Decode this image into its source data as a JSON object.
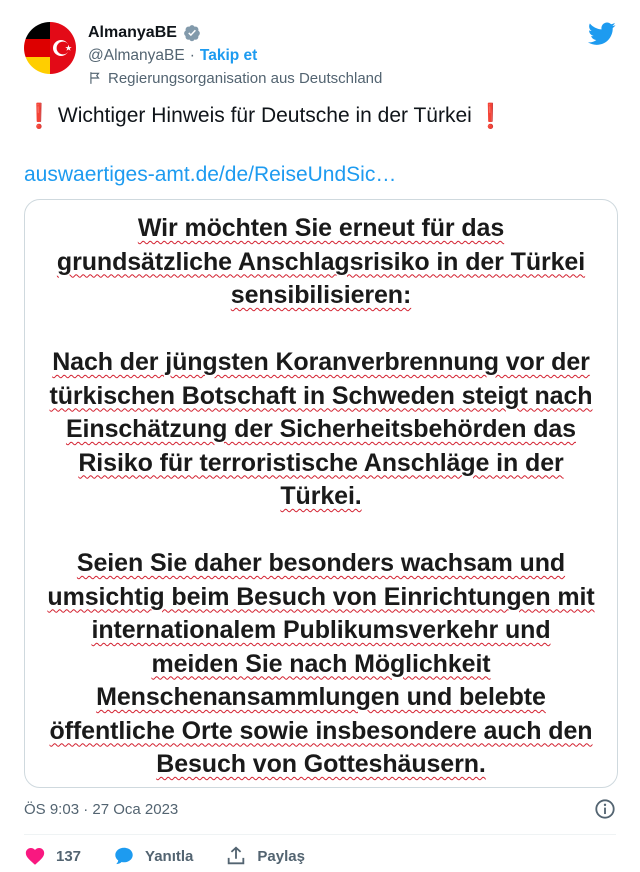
{
  "account": {
    "display_name": "AlmanyaBE",
    "handle": "@AlmanyaBE",
    "separator": "·",
    "follow_label": "Takip et",
    "affiliation": "Regierungsorganisation aus Deutschland"
  },
  "tweet": {
    "emoji_left": "❗",
    "text": "Wichtiger Hinweis für Deutsche in der Türkei",
    "emoji_right": "❗",
    "link": "auswaertiges-amt.de/de/ReiseUndSic…"
  },
  "media": {
    "paragraphs": [
      [
        "Wir möchten Sie erneut für das",
        "grundsätzliche Anschlagsrisiko in der Türkei",
        "sensibilisieren:"
      ],
      [
        "Nach der jüngsten Koranverbrennung vor der",
        "türkischen Botschaft in Schweden steigt nach",
        "Einschätzung der Sicherheitsbehörden das",
        "Risiko für terroristische Anschläge in der",
        "Türkei."
      ],
      [
        "Seien Sie daher besonders wachsam und",
        "umsichtig beim Besuch von Einrichtungen mit",
        "internationalem Publikumsverkehr und",
        "meiden Sie nach Möglichkeit",
        "Menschenansammlungen und belebte",
        "öffentliche Orte sowie insbesondere auch den",
        "Besuch von Gotteshäusern."
      ]
    ]
  },
  "meta": {
    "timestamp": "ÖS 9:03 · 27 Oca 2023"
  },
  "actions": {
    "likes_count": "137",
    "reply_label": "Yanıtla",
    "share_label": "Paylaş"
  },
  "icons": {
    "verified": "verified-badge-icon",
    "twitter": "twitter-bird-icon",
    "flag": "flag-icon",
    "info": "info-icon",
    "like": "heart-icon",
    "reply": "speech-bubble-icon",
    "share": "share-upload-icon"
  },
  "colors": {
    "accent": "#1d9bf0",
    "like": "#f91880",
    "secondary_text": "#536471",
    "emoji_red": "#dd2e44"
  }
}
